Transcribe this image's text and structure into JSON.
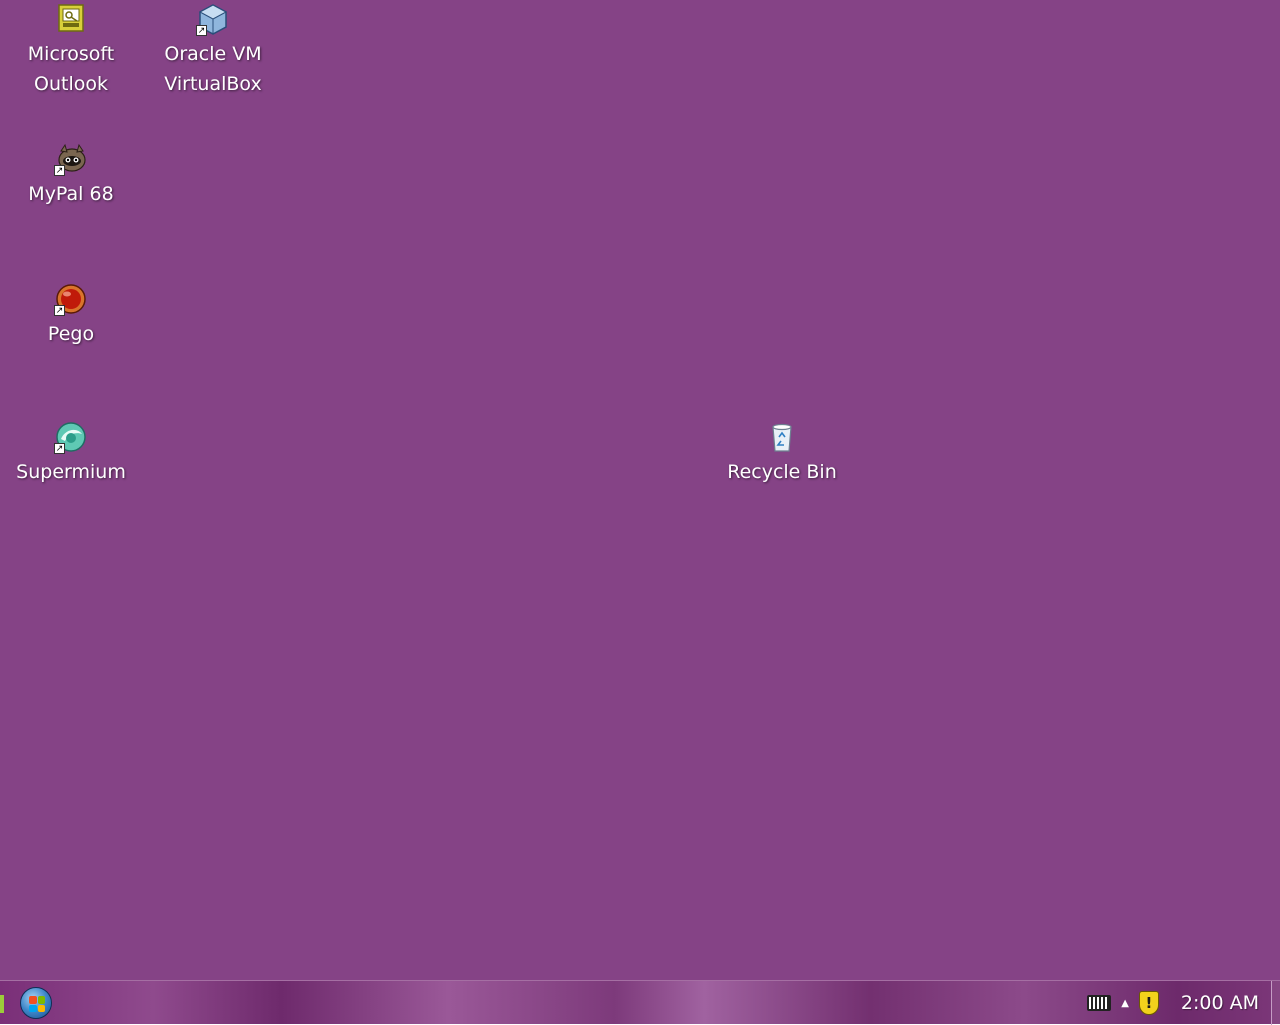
{
  "desktop": {
    "background_color": "#854386",
    "icons": [
      {
        "label": "Microsoft\nOutlook",
        "icon": "outlook-icon",
        "shortcut": false
      },
      {
        "label": "Oracle VM\nVirtualBox",
        "icon": "virtualbox-icon",
        "shortcut": true
      },
      {
        "label": "MyPal 68",
        "icon": "mypal-icon",
        "shortcut": true
      },
      {
        "label": "Pego",
        "icon": "pego-icon",
        "shortcut": true
      },
      {
        "label": "Supermium",
        "icon": "supermium-icon",
        "shortcut": true
      },
      {
        "label": "Recycle Bin",
        "icon": "recycle-bin-icon",
        "shortcut": false
      }
    ]
  },
  "taskbar": {
    "start_button": "start-button",
    "tray": {
      "icons": [
        "keyboard-icon",
        "show-hidden-icons-arrow",
        "security-shield-icon"
      ],
      "clock": "2:00 AM"
    }
  }
}
